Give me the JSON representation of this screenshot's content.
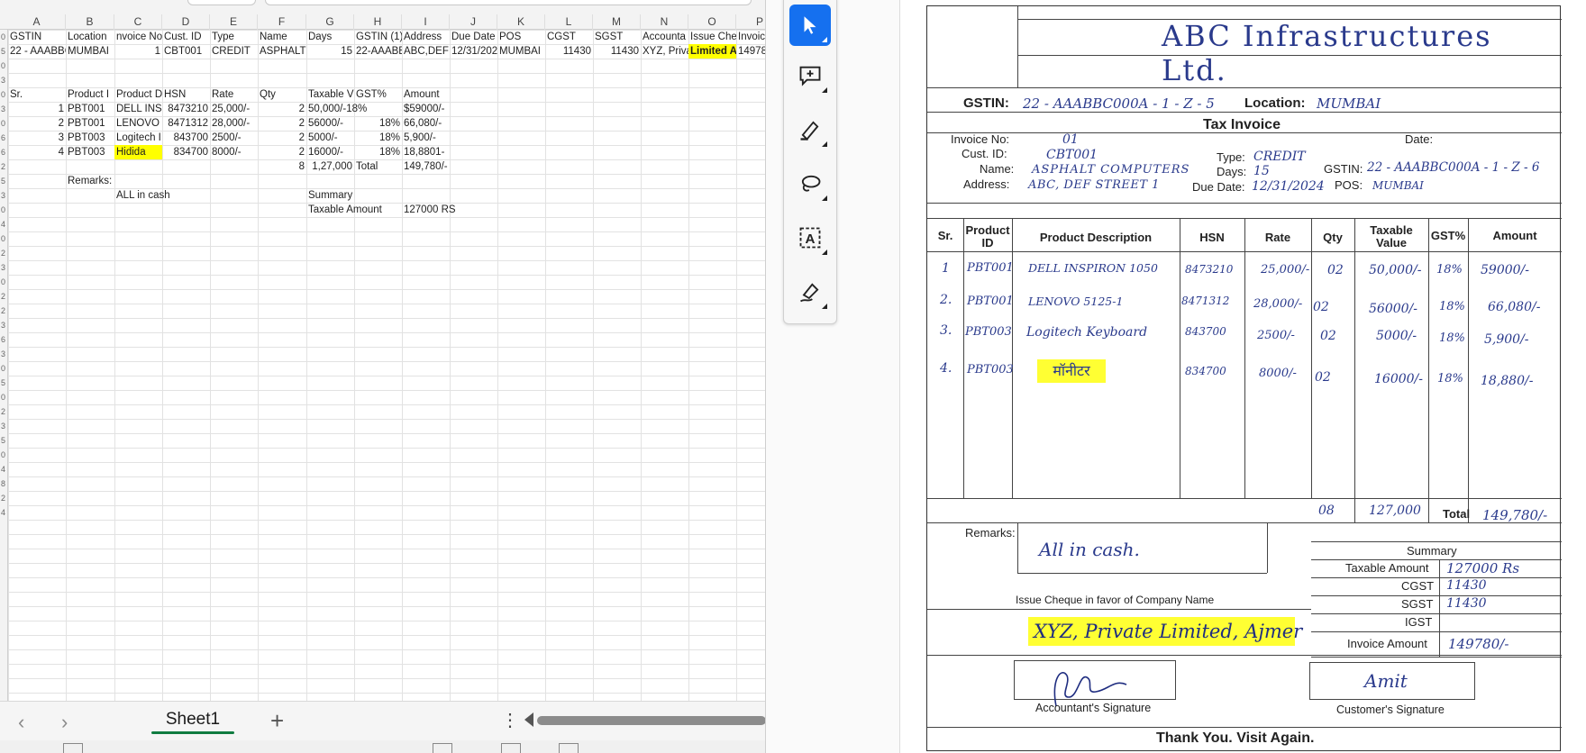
{
  "spreadsheet": {
    "columns": [
      "A",
      "B",
      "C",
      "D",
      "E",
      "F",
      "G",
      "H",
      "I",
      "J",
      "K",
      "L",
      "M",
      "N",
      "O",
      "P"
    ],
    "header_row": [
      "GSTIN",
      "Location",
      "nvoice No",
      "Cust. ID",
      "Type",
      "Name",
      "Days",
      "GSTIN (1)",
      "Address",
      "Due Date",
      "POS",
      "CGST",
      "SGST",
      "Accounta",
      "Issue Che",
      "Invoic"
    ],
    "data_row": [
      "22 - AAABBC",
      "MUMBAI",
      "1",
      "CBT001",
      "CREDIT",
      "ASPHALT C",
      "15",
      "22-AAABB",
      "ABC,DEF S",
      "12/31/202",
      "MUMBAI",
      "11430",
      "11430",
      "XYZ, Priva",
      "Limited Ai",
      "14978"
    ],
    "items_header": [
      "Sr.",
      "Product I",
      "Product D",
      "HSN",
      "Rate",
      "Qty",
      "Taxable V",
      "GST%",
      "Amount"
    ],
    "items": [
      [
        "1",
        "PBT001",
        "DELL INS I",
        "8473210",
        "25,000/-",
        "2",
        "50,000/-18%",
        "",
        "$59000/-"
      ],
      [
        "2",
        "PBT001",
        "LENOVO 5",
        "8471312",
        "28,000/-",
        "2",
        "56000/-",
        "18%",
        "66,080/-"
      ],
      [
        "3",
        "PBT003",
        "Logitech I",
        "843700",
        "2500/-",
        "2",
        "5000/-",
        "18%",
        "5,900/-"
      ],
      [
        "4",
        "PBT003",
        "Hidida",
        "834700",
        "8000/-",
        "2",
        "16000/-",
        "18%",
        "18,8801-"
      ]
    ],
    "totals_row": [
      "8",
      "1,27,000",
      "Total",
      "149,780/-"
    ],
    "remarks_label": "Remarks:",
    "remarks_value": "ALL in cash",
    "summary_label": "Summary",
    "taxable_label": "Taxable Amount",
    "taxable_value": "127000 RS",
    "row_numbers": [
      "0",
      "5",
      "0",
      "3",
      "0",
      "3",
      "0",
      "6",
      "6",
      "2",
      "5",
      "3",
      "0",
      "4",
      "0",
      "2",
      "3",
      "0",
      "2",
      "2",
      "3",
      "6",
      "3",
      "0",
      "5",
      "0",
      "2",
      "3",
      "5",
      "0",
      "4",
      "8",
      "2",
      "4"
    ],
    "sheet_tab": "Sheet1",
    "add_sheet": "+",
    "more": "⋮",
    "nav_prev": "‹",
    "nav_next": "›",
    "highlight_color": "#ffff00",
    "tab_accent": "#107c41"
  },
  "toolbar": {
    "accent": "#1570ef",
    "tools": [
      "select-icon",
      "add-comment-icon",
      "highlight-pen-icon",
      "lasso-icon",
      "text-recognition-icon",
      "sign-pen-icon"
    ],
    "text_tool_glyph": "A"
  },
  "invoice": {
    "company": "ABC Infrastructures Ltd.",
    "gstin_label": "GSTIN:",
    "gstin_value": "22 - AAABBC000A - 1 - Z - 5",
    "location_label": "Location:",
    "location_value": "MUMBAI",
    "title": "Tax Invoice",
    "invoice_no_label": "Invoice No:",
    "invoice_no_value": "01",
    "date_label": "Date:",
    "cust_label": "Cust. ID:",
    "cust_value": "CBT001",
    "type_label": "Type:",
    "type_value": "CREDIT",
    "name_label": "Name:",
    "name_value": "ASPHALT COMPUTERS",
    "days_label": "Days:",
    "days_value": "15",
    "gstin2_label": "GSTIN:",
    "gstin2_value": "22 - AAABBC000A - 1 - Z - 6",
    "address_label": "Address:",
    "address_value": "ABC, DEF STREET 1",
    "due_label": "Due Date:",
    "due_value": "12/31/2024",
    "pos_label": "POS:",
    "pos_value": "MUMBAI",
    "table_headers": [
      "Sr.",
      "Product ID",
      "Product Description",
      "HSN",
      "Rate",
      "Qty",
      "Taxable Value",
      "GST%",
      "Amount"
    ],
    "rows": [
      {
        "sr": "1",
        "pid": "PBT001",
        "desc": "DELL INSPIRON 1050",
        "hsn": "8473210",
        "rate": "25,000/-",
        "qty": "02",
        "taxable": "50,000/-",
        "gst": "18%",
        "amount": "59000/-"
      },
      {
        "sr": "2.",
        "pid": "PBT001",
        "desc": "LENOVO 5125-1",
        "hsn": "8471312",
        "rate": "28,000/-",
        "qty": "02",
        "taxable": "56000/-",
        "gst": "18%",
        "amount": "66,080/-"
      },
      {
        "sr": "3.",
        "pid": "PBT003",
        "desc": "Logitech Keyboard",
        "hsn": "843700",
        "rate": "2500/-",
        "qty": "02",
        "taxable": "5000/-",
        "gst": "18%",
        "amount": "5,900/-"
      },
      {
        "sr": "4.",
        "pid": "PBT003",
        "desc": "मॉनीटर",
        "hsn": "834700",
        "rate": "8000/-",
        "qty": "02",
        "taxable": "16000/-",
        "gst": "18%",
        "amount": "18,880/-"
      }
    ],
    "total_qty": "08",
    "total_taxable": "127,000",
    "total_label": "Total",
    "total_amount": "149,780/-",
    "remarks_label": "Remarks:",
    "remarks_value": "All in cash.",
    "summary_label": "Summary",
    "taxable_amount_label": "Taxable Amount",
    "taxable_amount_value": "127000 Rs",
    "cgst_label": "CGST",
    "cgst_value": "11430",
    "sgst_label": "SGST",
    "sgst_value": "11430",
    "igst_label": "IGST",
    "igst_value": "",
    "invoice_amount_label": "Invoice Amount",
    "invoice_amount_value": "149780/-",
    "cheque_label": "Issue Cheque in favor of Company Name",
    "cheque_value": "XYZ, Private Limited, Ajmer",
    "accountant_sig_label": "Accountant's Signature",
    "customer_sig_label": "Customer's Signature",
    "customer_sig_value": "Amit",
    "footer": "Thank You. Visit Again.",
    "highlight_color": "#ffff33",
    "ink_color": "#2a3a8c"
  }
}
